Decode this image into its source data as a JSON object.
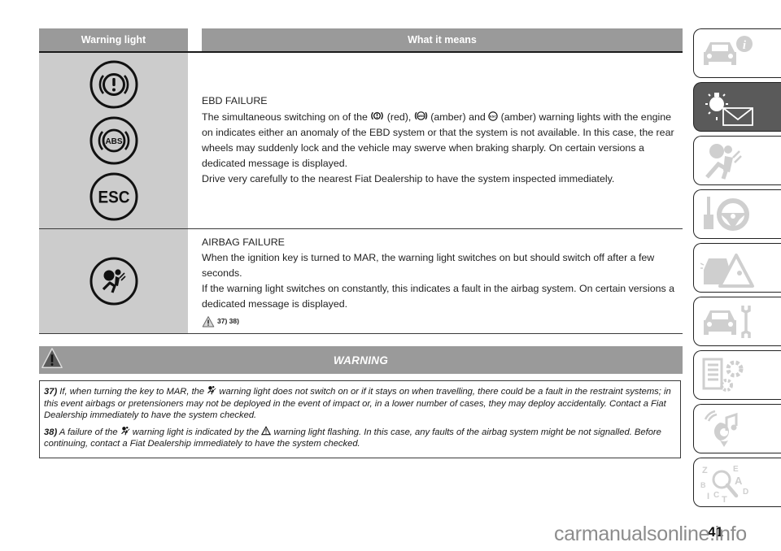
{
  "table": {
    "headers": [
      "Warning light",
      "What it means"
    ],
    "rows": [
      {
        "icons": [
          "brake-warning-icon",
          "abs-icon",
          "esc-icon"
        ],
        "icon_labels": {
          "abs": "ABS",
          "esc": "ESC"
        },
        "title": "EBD FAILURE",
        "line1_a": "The simultaneous switching on of the ",
        "line1_b": " (red), ",
        "line1_c": " (amber) and ",
        "line1_d": " (amber) warning lights with the engine on indicates either an anomaly of the EBD system or that the system is not available. In this case, the rear wheels may suddenly lock and the vehicle may swerve when braking sharply. On certain versions a dedicated message is displayed.",
        "line2": "Drive very carefully to the nearest Fiat Dealership to have the system inspected immediately."
      },
      {
        "icons": [
          "airbag-warning-icon"
        ],
        "title": "AIRBAG FAILURE",
        "line1": "When the ignition key is turned to MAR, the warning light switches on but should switch off after a few seconds.",
        "line2": "If the warning light switches on constantly, this indicates a fault in the airbag system. On certain versions a dedicated message is displayed.",
        "refs": "37) 38)"
      }
    ]
  },
  "warning": {
    "title": "WARNING",
    "notes": [
      {
        "num": "37)",
        "a": " If, when turning the key to MAR, the ",
        "b": " warning light does not switch on or if it stays on when travelling, there could be a fault in the restraint systems; in this event airbags or pretensioners may not be deployed in the event of impact or, in a lower number of cases, they may deploy accidentally. Contact a Fiat Dealership immediately to have the system checked."
      },
      {
        "num": "38)",
        "a": " A failure of the ",
        "b": " warning light is indicated by the ",
        "c": " warning light flashing. In this case, any faults of the airbag system might be not signalled. Before continuing, contact a Fiat Dealership immediately to have the system checked."
      }
    ]
  },
  "sidebar": {
    "tabs": [
      {
        "icon": "car-info-icon",
        "active": false
      },
      {
        "icon": "warning-lights-icon",
        "active": true
      },
      {
        "icon": "safety-airbag-icon",
        "active": false
      },
      {
        "icon": "key-steering-wheel-icon",
        "active": false
      },
      {
        "icon": "emergency-icon",
        "active": false
      },
      {
        "icon": "car-maintenance-icon",
        "active": false
      },
      {
        "icon": "technical-data-icon",
        "active": false
      },
      {
        "icon": "multimedia-icon",
        "active": false
      },
      {
        "icon": "index-icon",
        "active": false
      }
    ],
    "colors": {
      "tab_icon": "#cfcfcf",
      "active_tab": "#5a5a5a"
    }
  },
  "page_number": "41",
  "watermark": "carmanualsonline.info"
}
